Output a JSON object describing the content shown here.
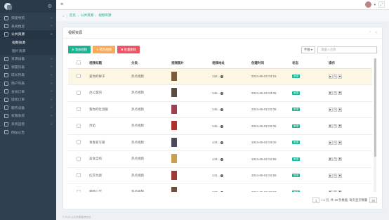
{
  "sidebar": {
    "items": [
      {
        "label": "快速导航",
        "icon": "home-icon",
        "expandable": true
      },
      {
        "label": "系统档案",
        "icon": "folder-icon",
        "expandable": true
      },
      {
        "label": "公共资源",
        "icon": "cube-icon",
        "expandable": true,
        "active": true
      },
      {
        "label": "资源设备",
        "icon": "device-icon",
        "expandable": true
      },
      {
        "label": "保置列表",
        "icon": "list-icon",
        "expandable": true
      },
      {
        "label": "成长列表",
        "icon": "list-icon",
        "expandable": true
      },
      {
        "label": "用户列表",
        "icon": "user-icon",
        "expandable": true
      },
      {
        "label": "会员订单",
        "icon": "order-icon",
        "expandable": true
      },
      {
        "label": "提现订单",
        "icon": "order-icon",
        "expandable": true
      },
      {
        "label": "服务设备",
        "icon": "server-icon",
        "expandable": true
      },
      {
        "label": "权限系统",
        "icon": "lock-icon",
        "expandable": true
      },
      {
        "label": "系统运营",
        "icon": "gear-icon",
        "expandable": true
      },
      {
        "label": "网站公告",
        "icon": "bell-icon",
        "expandable": false
      }
    ],
    "submenu": [
      {
        "label": "视频资源",
        "active": true
      },
      {
        "label": "图片资源",
        "active": false
      }
    ]
  },
  "breadcrumb": {
    "home": "首页",
    "section": "公共资源",
    "current": "视频资源"
  },
  "panel": {
    "title": "视频资源"
  },
  "toolbar": {
    "add_label": "添加视频",
    "edit_label": "修改视频",
    "delete_label": "批量删除",
    "filter_value": "不限",
    "search_placeholder": "请输入名称"
  },
  "table": {
    "headers": [
      "视频标题",
      "分类",
      "视频图片",
      "视频地址",
      "创建时间",
      "状态",
      "操作"
    ],
    "rows": [
      {
        "title": "爱你的样子",
        "category": "热点视频",
        "thumb_color": "#7a5a3a",
        "url": "132...",
        "time": "2024-06-02 03:19",
        "status": "启用",
        "highlight": true
      },
      {
        "title": "办公室的",
        "category": "热点视频",
        "thumb_color": "#5a4a3f",
        "url": "145...",
        "time": "2024-06-02 03:09",
        "status": "启用",
        "highlight": false
      },
      {
        "title": "我你的吐温暖",
        "category": "热点视频",
        "thumb_color": "#9a4050",
        "url": "145...",
        "time": "2024-06-02 03:08",
        "status": "启用",
        "highlight": false
      },
      {
        "title": "烈焰",
        "category": "热点视频",
        "thumb_color": "#b03030",
        "url": "145...",
        "time": "2024-06-02 03:06",
        "status": "启用",
        "highlight": false
      },
      {
        "title": "青春爱写著",
        "category": "热点视频",
        "thumb_color": "#4a4a5a",
        "url": "143...",
        "time": "2024-06-02 03:00",
        "status": "启用",
        "highlight": false
      },
      {
        "title": "美食自购",
        "category": "热点视频",
        "thumb_color": "#c8a050",
        "url": "143...",
        "time": "2024-06-02 02:59",
        "status": "启用",
        "highlight": false
      },
      {
        "title": "红衣为颜",
        "category": "热点视频",
        "thumb_color": "#a03838",
        "url": "141...",
        "time": "2024-06-02 02:58",
        "status": "启用",
        "highlight": false
      },
      {
        "title": "相伴公案",
        "category": "热点视频",
        "thumb_color": "#6a5040",
        "url": "137...",
        "time": "2024-06-02 02:57",
        "status": "启用",
        "highlight": false
      },
      {
        "title": "",
        "category": "",
        "thumb_color": "#8a7060",
        "url": "",
        "time": "",
        "status": "",
        "highlight": false
      }
    ]
  },
  "pager": {
    "page": "1",
    "summary": "/ 1 页, 共 18 条数据, 每页显示数量",
    "page_size": "20"
  },
  "footer": {
    "text": "© 2024 公共资源管理系统"
  }
}
